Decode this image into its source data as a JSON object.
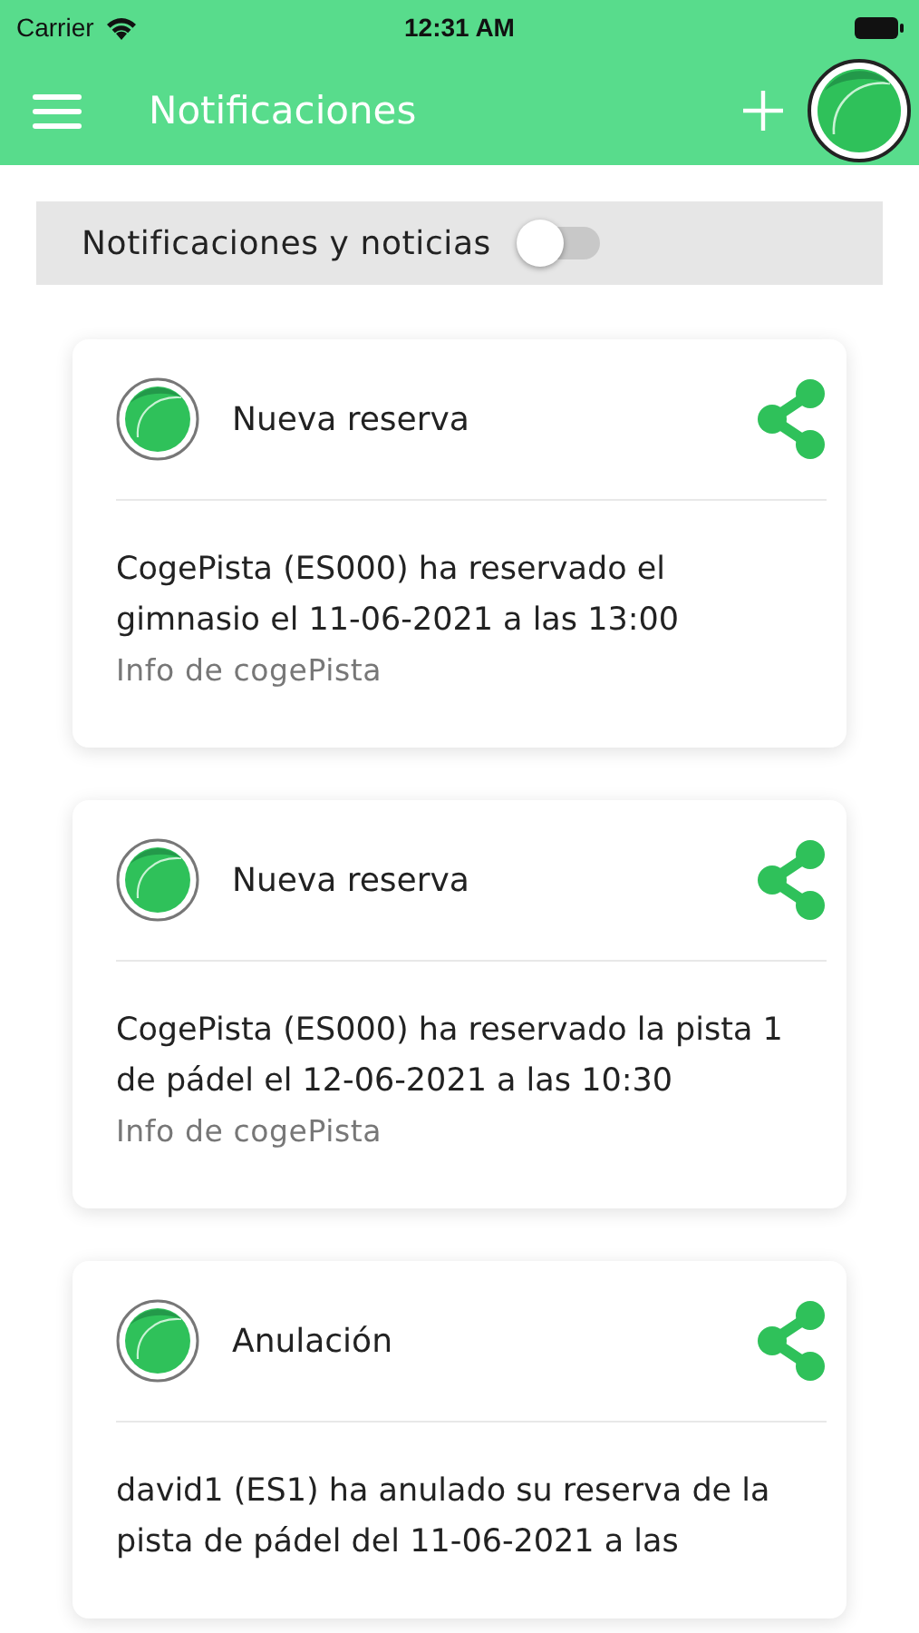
{
  "status_bar": {
    "carrier": "Carrier",
    "time": "12:31 AM"
  },
  "header": {
    "title": "Notificaciones"
  },
  "filter": {
    "label": "Notificaciones y noticias",
    "on": false
  },
  "notifications": [
    {
      "title": "Nueva reserva",
      "message": "CogePista (ES000) ha reservado el gimnasio el 11-06-2021 a las 13:00",
      "source": "Info de cogePista"
    },
    {
      "title": "Nueva reserva",
      "message": "CogePista (ES000) ha reservado la pista 1 de pádel el 12-06-2021 a las 10:30",
      "source": "Info de cogePista"
    },
    {
      "title": "Anulación",
      "message": "david1 (ES1) ha anulado su reserva de la pista de pádel del 11-06-2021 a las"
    }
  ]
}
